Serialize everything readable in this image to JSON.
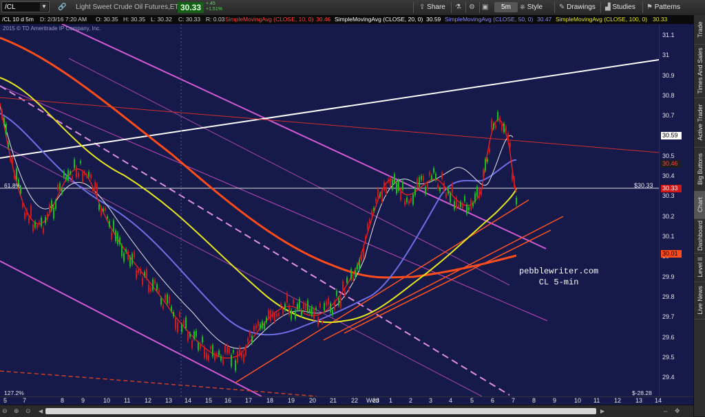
{
  "toolbar": {
    "symbol": "/CL",
    "instrument_name": "Light Sweet Crude Oil Futures,ETH",
    "last_price": "30.33",
    "change": "+.45",
    "change_pct": "+1.51%",
    "share_label": "Share",
    "timeframe": "5m",
    "style_label": "Style",
    "drawings_label": "Drawings",
    "studies_label": "Studies",
    "patterns_label": "Patterns"
  },
  "subbar": {
    "chart_title": "/CL 10 d 5m",
    "date": "D: 2/3/16 7:20 AM",
    "open": "O: 30.35",
    "high": "H: 30.35",
    "low": "L: 30.32",
    "close": "C: 30.33",
    "range": "R: 0.03",
    "sma10_label": "SimpleMovingAvg (CLOSE, 10, 0)",
    "sma10_value": "30.46",
    "sma20_label": "SimpleMovingAvg (CLOSE, 20, 0)",
    "sma20_value": "30.59",
    "sma50_label": "SimpleMovingAvg (CLOSE, 50, 0)",
    "sma50_value": "30.47",
    "sma100_label": "SimpleMovingAvg (CLOSE, 100, 0)",
    "sma100_value": "30.33"
  },
  "chart": {
    "copyright": "2015 © TD Ameritrade IP Company, Inc.",
    "fib_label": "61.8%",
    "price_line_label": "$30.33",
    "watermark_line1": "pebblewriter.com",
    "watermark_line2": "CL 5-min",
    "bottom_left_label": "127.2%",
    "bottom_right_label": "$-28.28"
  },
  "yaxis": {
    "ticks": [
      "31.1",
      "31",
      "30.9",
      "30.8",
      "30.7",
      "30.6",
      "30.5",
      "30.4",
      "30.3",
      "30.2",
      "30.1",
      "30",
      "29.9",
      "29.8",
      "29.7",
      "29.6",
      "29.5",
      "29.4"
    ],
    "tag_sma20": "30.59",
    "tag_sma10": "30.46",
    "tag_price": "30.33",
    "tag_sma200": "30.01"
  },
  "xaxis": {
    "ticks": [
      "5",
      "7",
      "8",
      "9",
      "10",
      "11",
      "12",
      "13",
      "14",
      "15",
      "16",
      "17",
      "18",
      "19",
      "20",
      "21",
      "22",
      "23",
      "Wed",
      "1",
      "2",
      "3",
      "4",
      "5",
      "6",
      "7",
      "8",
      "9",
      "10",
      "11",
      "12",
      "13",
      "14"
    ]
  },
  "sidepanel": {
    "tabs": [
      "Trade",
      "Times And Sales",
      "Active Trader",
      "Big Buttons",
      "Chart",
      "Dashboard",
      "Level II",
      "Live News"
    ]
  },
  "colors": {
    "chart_bg": "#161a4a",
    "sma10": "#e02020",
    "sma20": "#e8e8e8",
    "sma50": "#6f6fe8",
    "sma100": "#e8e820",
    "sma200": "#ff4c1a",
    "channel": "#d35ad3",
    "price_up": "#18c018",
    "price_down": "#d01818"
  }
}
